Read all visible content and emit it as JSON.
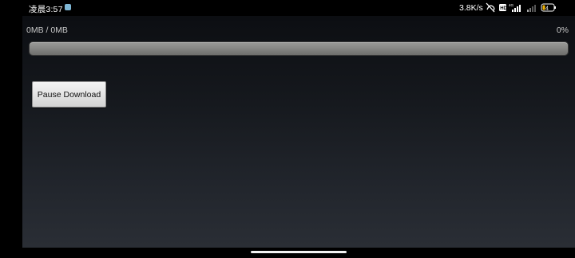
{
  "status_bar": {
    "time": "凌晨3:57",
    "network_speed": "3.8K/s",
    "icons": [
      "notification-dot-icon",
      "nfc-off-icon",
      "hd-icon",
      "signal-4g-icon",
      "signal-weak-icon",
      "battery-icon"
    ],
    "battery_level": "4"
  },
  "download": {
    "progress_text": "0MB / 0MB",
    "percent_text": "0%",
    "progress": 0,
    "pause_label": "Pause Download"
  },
  "colors": {
    "background_top": "#0c0e12",
    "background_bottom": "#2a2e35",
    "progress_track": "#8a8a88"
  }
}
